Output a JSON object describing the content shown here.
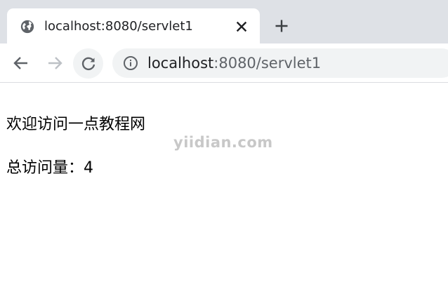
{
  "tab": {
    "title": "localhost:8080/servlet1",
    "favicon": "globe-icon",
    "close_icon": "close-icon"
  },
  "tab_strip": {
    "new_tab_icon": "plus-icon"
  },
  "toolbar": {
    "back_icon": "arrow-left-icon",
    "forward_icon": "arrow-right-icon",
    "reload_icon": "reload-icon",
    "site_info_icon": "info-icon"
  },
  "address_bar": {
    "host": "localhost",
    "rest": ":8080/servlet1"
  },
  "page": {
    "welcome": "欢迎访问一点教程网",
    "visit_label": "总访问量：",
    "visit_count": "4"
  },
  "watermark": "yiidian.com",
  "colors": {
    "tab_strip": "#dee1e6",
    "omnibox": "#f1f3f4",
    "icon": "#5f6368",
    "icon_disabled": "#bdc1c6",
    "text": "#202124"
  }
}
